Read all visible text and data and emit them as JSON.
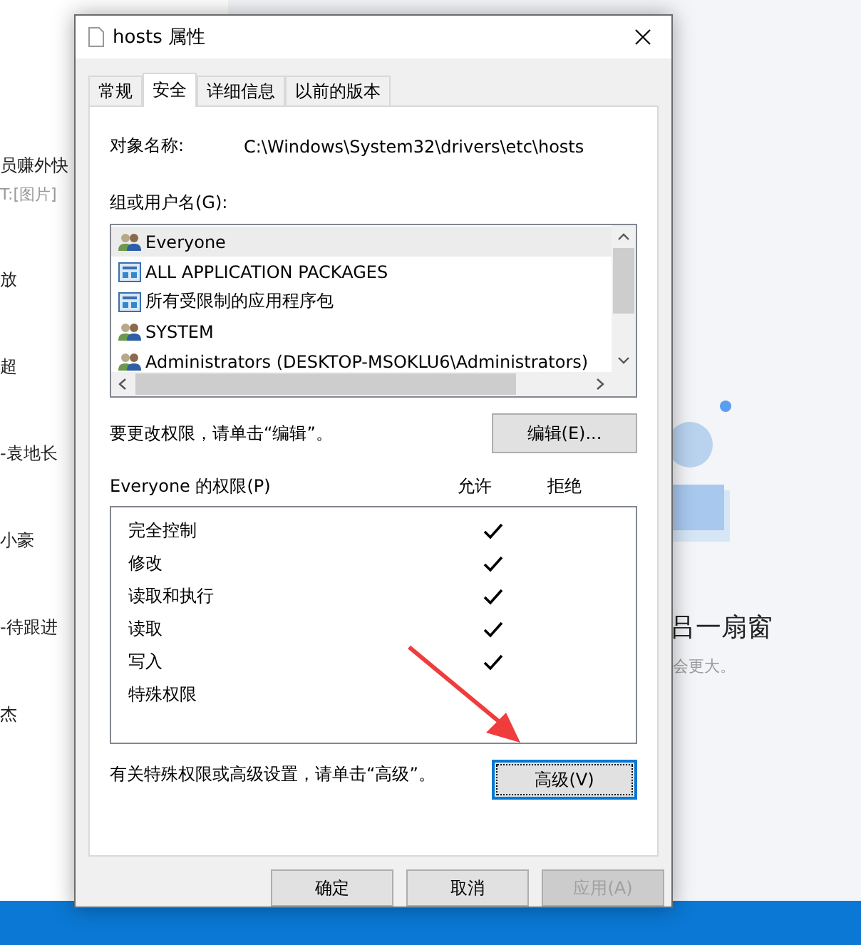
{
  "background": {
    "left_items": [
      {
        "text": "员赚外快",
        "kind": "title"
      },
      {
        "text": "T:[图片]",
        "kind": "subtitle"
      },
      {
        "text": "放",
        "kind": "title"
      },
      {
        "text": "超",
        "kind": "title"
      },
      {
        "text": "-袁地长",
        "kind": "title"
      },
      {
        "text": "小豪",
        "kind": "title"
      },
      {
        "text": "-待跟进",
        "kind": "title"
      },
      {
        "text": "杰",
        "kind": "title"
      }
    ],
    "right_heading": "吕一扇窗",
    "right_subtext": "会更大。"
  },
  "window": {
    "title": "hosts 属性"
  },
  "tabs": [
    {
      "label": "常规",
      "selected": false
    },
    {
      "label": "安全",
      "selected": true
    },
    {
      "label": "详细信息",
      "selected": false
    },
    {
      "label": "以前的版本",
      "selected": false
    }
  ],
  "object_name": {
    "label": "对象名称:",
    "value": "C:\\Windows\\System32\\drivers\\etc\\hosts"
  },
  "users": {
    "label": "组或用户名(G):",
    "items": [
      {
        "name": "Everyone",
        "kind": "group",
        "selected": true
      },
      {
        "name": "ALL APPLICATION PACKAGES",
        "kind": "package",
        "selected": false
      },
      {
        "name": "所有受限制的应用程序包",
        "kind": "package",
        "selected": false
      },
      {
        "name": "SYSTEM",
        "kind": "group",
        "selected": false
      },
      {
        "name": "Administrators (DESKTOP-MSOKLU6\\Administrators)",
        "kind": "group",
        "selected": false
      }
    ]
  },
  "edit_hint": "要更改权限，请单击“编辑”。",
  "edit_button": "编辑(E)...",
  "permissions": {
    "label": "Everyone 的权限(P)",
    "columns": [
      "允许",
      "拒绝"
    ],
    "rows": [
      {
        "name": "完全控制",
        "allow": true,
        "deny": false
      },
      {
        "name": "修改",
        "allow": true,
        "deny": false
      },
      {
        "name": "读取和执行",
        "allow": true,
        "deny": false
      },
      {
        "name": "读取",
        "allow": true,
        "deny": false
      },
      {
        "name": "写入",
        "allow": true,
        "deny": false
      },
      {
        "name": "特殊权限",
        "allow": false,
        "deny": false
      }
    ]
  },
  "advanced_hint": "有关特殊权限或高级设置，请单击“高级”。",
  "advanced_button": {
    "label": "高级(V)",
    "focused": true
  },
  "buttons": [
    {
      "label": "确定",
      "disabled": false
    },
    {
      "label": "取消",
      "disabled": false
    },
    {
      "label": "应用(A)",
      "disabled": true
    }
  ]
}
